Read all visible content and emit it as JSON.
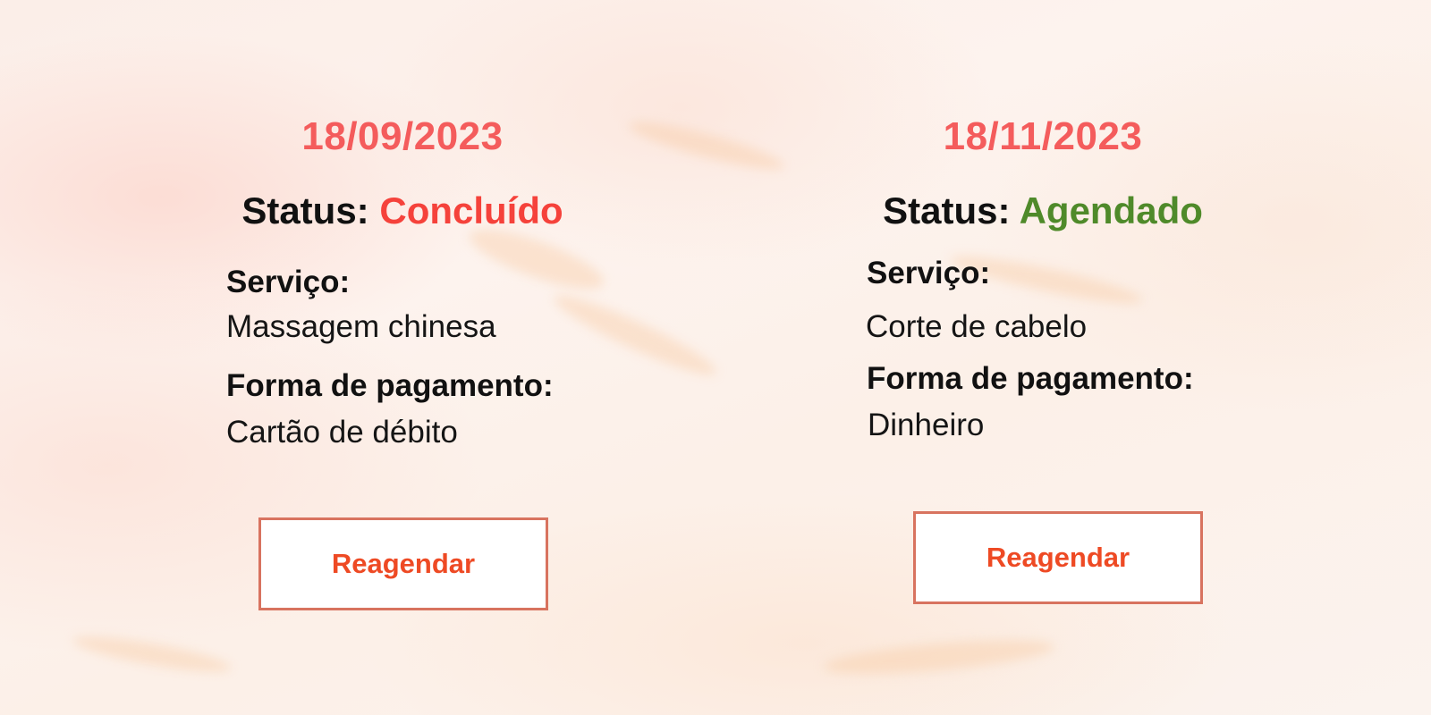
{
  "colors": {
    "date": "#f45c5c",
    "status_done": "#f5423b",
    "status_scheduled": "#4f8a2a",
    "button_text": "#ee4a24",
    "button_border": "#d8735f"
  },
  "appointments": [
    {
      "date": "18/09/2023",
      "status_label": "Status:",
      "status_value": "Concluído",
      "service_label": "Serviço:",
      "service_value": "Massagem chinesa",
      "payment_label": "Forma de pagamento:",
      "payment_value": "Cartão de débito",
      "action_label": "Reagendar"
    },
    {
      "date": "18/11/2023",
      "status_label": "Status:",
      "status_value": "Agendado",
      "service_label": "Serviço:",
      "service_value": "Corte de cabelo",
      "payment_label": "Forma de pagamento:",
      "payment_value": "Dinheiro",
      "action_label": "Reagendar"
    }
  ]
}
